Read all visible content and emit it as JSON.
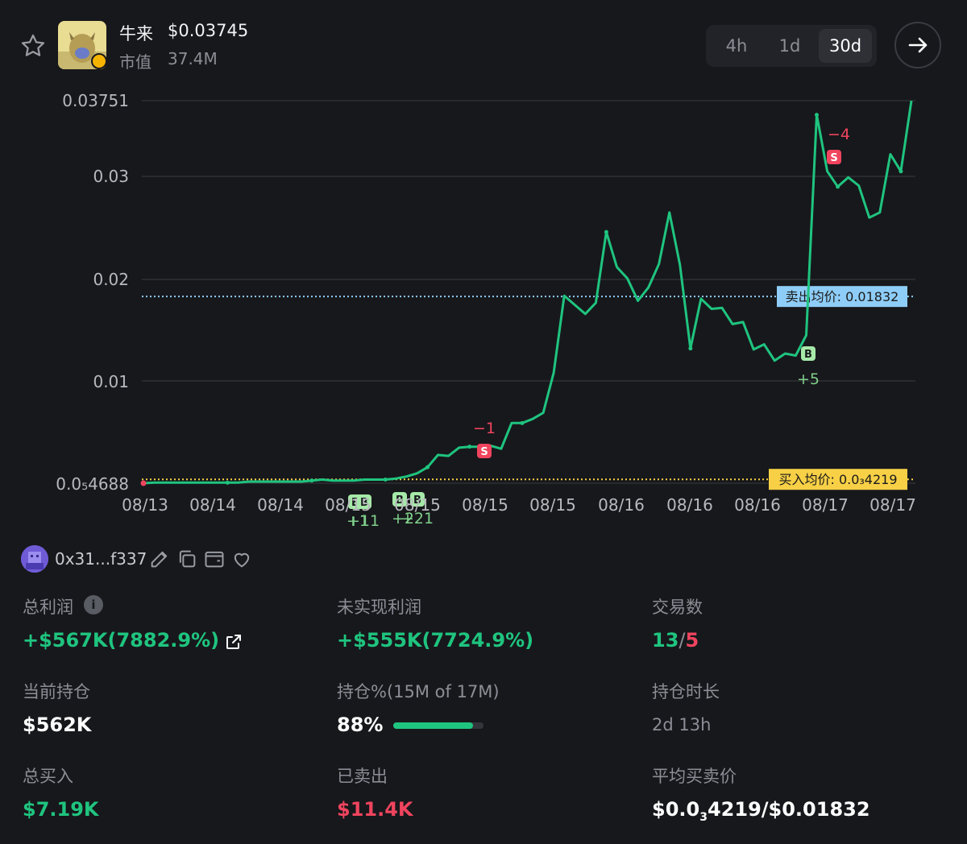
{
  "token": {
    "name": "牛来",
    "price": "$0.03745",
    "market_cap_label": "市值",
    "market_cap_value": "37.4M",
    "favorite_icon": "star-outline-icon"
  },
  "timeframes": {
    "options": [
      "4h",
      "1d",
      "30d"
    ],
    "selected": "30d"
  },
  "chart_data": {
    "type": "line",
    "y_tick_labels": [
      "0.03751",
      "0.03",
      "0.02",
      "0.01",
      "0.0₅4688"
    ],
    "x_tick_labels": [
      "08/13",
      "08/14",
      "08/14",
      "08/15",
      "08/15",
      "08/15",
      "08/15",
      "08/16",
      "08/16",
      "08/16",
      "08/17",
      "08/17"
    ],
    "ylim": [
      4.69e-05,
      0.03751
    ],
    "grid": true,
    "line_color": "#1fc47f",
    "reference_lines": [
      {
        "label": "卖出均价: 0.01832",
        "value": 0.01832,
        "color": "#8ecdf7"
      },
      {
        "label": "买入均价: 0.0₃4219",
        "value": 0.0004219,
        "color": "#f7d046"
      }
    ],
    "trade_markers": [
      {
        "type": "S",
        "amount": "−1",
        "color": "#f0445e"
      },
      {
        "type": "S",
        "amount": "−4",
        "color": "#f0445e"
      },
      {
        "type": "B",
        "amount": "+5",
        "color": "#a6e9a8"
      },
      {
        "type": "B",
        "amount": "+11",
        "color": "#a6e9a8"
      },
      {
        "type": "B",
        "amount": "+1",
        "color": "#a6e9a8"
      },
      {
        "type": "B",
        "amount": "+2",
        "color": "#a6e9a8"
      },
      {
        "type": "B",
        "amount": "+21",
        "color": "#a6e9a8"
      }
    ],
    "series": [
      {
        "values": [
          4.69e-05,
          0.0001,
          0.0001,
          0.0001,
          0.0001,
          0.0001,
          0.0001,
          0.0001,
          0.0001,
          0.0001,
          0.0002,
          0.0002,
          0.0002,
          0.0002,
          0.0002,
          0.0002,
          0.0003,
          0.0004,
          0.0003,
          0.0003,
          0.0003,
          0.0004,
          0.0004,
          0.0004,
          0.0005,
          0.0007,
          0.001,
          0.0016,
          0.0028,
          0.0027,
          0.0035,
          0.0036,
          0.0036,
          0.0037,
          0.0034,
          0.0059,
          0.0059,
          0.0063,
          0.0069,
          0.0108,
          0.0184,
          0.0175,
          0.0166,
          0.0177,
          0.0246,
          0.0212,
          0.0201,
          0.0179,
          0.0192,
          0.0215,
          0.0265,
          0.0214,
          0.0132,
          0.0181,
          0.0171,
          0.0172,
          0.0156,
          0.0158,
          0.0131,
          0.0136,
          0.012,
          0.0127,
          0.0125,
          0.0145,
          0.0361,
          0.0305,
          0.029,
          0.0299,
          0.0291,
          0.026,
          0.0265,
          0.0322,
          0.0305,
          0.0375
        ]
      }
    ]
  },
  "wallet": {
    "address": "0x31...f337",
    "icons": [
      "edit-icon",
      "copy-icon",
      "wallet-icon",
      "heart-icon"
    ]
  },
  "stats": {
    "total_profit_label": "总利润",
    "total_profit_value": "+$567K(7882.9%)",
    "unrealized_label": "未实现利润",
    "unrealized_value": "+$555K(7724.9%)",
    "trades_label": "交易数",
    "trades_buy": "13",
    "trades_sep": "/",
    "trades_sell": "5",
    "holding_label": "当前持仓",
    "holding_value": "$562K",
    "holding_pct_label": "持仓%(15M of 17M)",
    "holding_pct_value": "88%",
    "holding_pct_fraction": 0.88,
    "duration_label": "持仓时长",
    "duration_value": "2d 13h",
    "total_buy_label": "总买入",
    "total_buy_value": "$7.19K",
    "sold_label": "已卖出",
    "sold_value": "$11.4K",
    "avg_price_label": "平均买卖价",
    "avg_price_prefix": "$0.0",
    "avg_price_sub": "3",
    "avg_price_suffix": "4219/$0.01832"
  }
}
